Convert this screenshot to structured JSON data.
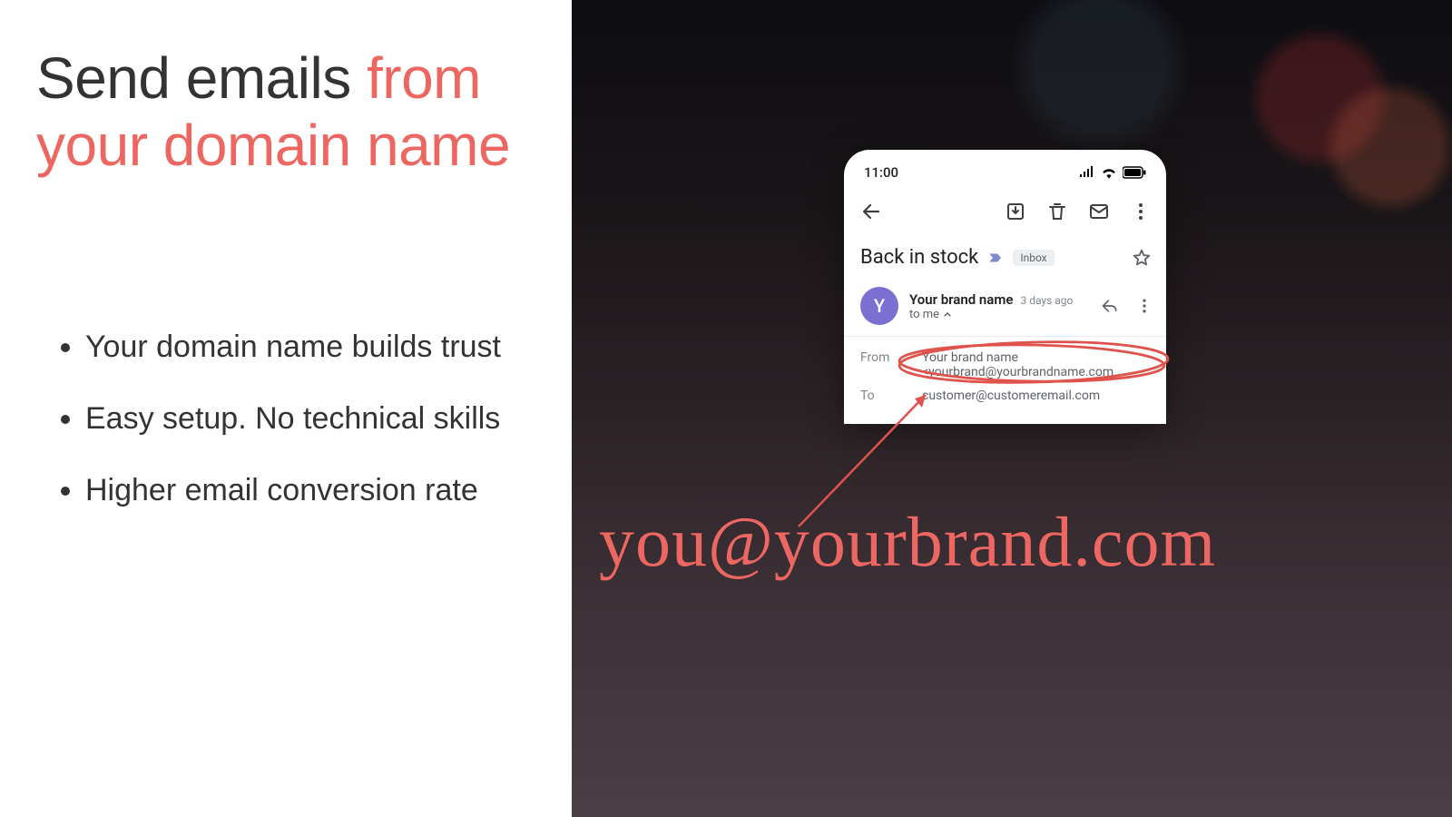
{
  "left": {
    "heading_plain": "Send emails ",
    "heading_accent": "from your domain name",
    "bullets": [
      "Your domain name builds trust",
      "Easy setup. No technical skills",
      "Higher email conversion rate"
    ]
  },
  "phone": {
    "time": "11:00",
    "subject": "Back in stock",
    "inbox_chip": "Inbox",
    "avatar_letter": "Y",
    "sender_name": "Your brand name",
    "sender_date": "3 days ago",
    "to_me": "to me",
    "details": {
      "from_label": "From",
      "from_value": "Your brand name <yourbrand@yourbrandname.com",
      "to_label": "To",
      "to_value": "customer@customeremail.com"
    }
  },
  "callout": "you@yourbrand.com",
  "colors": {
    "accent": "#ed6762"
  }
}
